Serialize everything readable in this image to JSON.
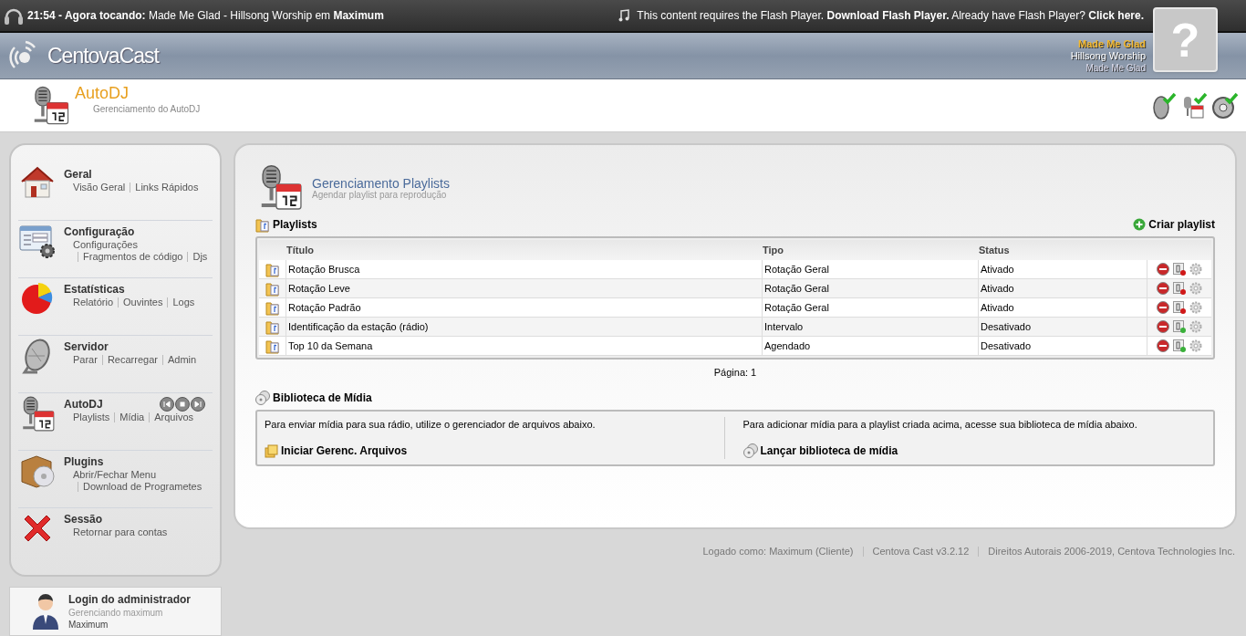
{
  "top_bar": {
    "time": "21:54 - ",
    "label": "Agora tocando:",
    "track": " Made Me Glad - Hillsong Worship em ",
    "station": "Maximum",
    "flash_notice": "This content requires the Flash Player.",
    "download_link": "Download Flash Player.",
    "already": "Already have Flash Player?",
    "click_link": "Click here."
  },
  "header": {
    "logo": "CentovaCast",
    "now_playing": {
      "title": "Made Me Glad",
      "artist": "Hillsong Worship",
      "album": "Made Me Glad"
    },
    "cover_placeholder": "?"
  },
  "page": {
    "title": "AutoDJ",
    "subtitle": "Gerenciamento do AutoDJ"
  },
  "sidebar": [
    {
      "kind": "house",
      "title": "Geral",
      "links": [
        "Visão Geral",
        "Links Rápidos"
      ]
    },
    {
      "kind": "form",
      "title": "Configuração",
      "links": [
        "Configurações",
        "Fragmentos de código",
        "Djs"
      ]
    },
    {
      "kind": "pie",
      "title": "Estatísticas",
      "links": [
        "Relatório",
        "Ouvintes",
        "Logs"
      ]
    },
    {
      "kind": "speaker",
      "title": "Servidor",
      "links": [
        "Parar",
        "Recarregar",
        "Admin"
      ]
    },
    {
      "kind": "autodj",
      "title": "AutoDJ",
      "links": [
        "Playlists",
        "Mídia",
        "Arquivos"
      ]
    },
    {
      "kind": "plugins",
      "title": "Plugins",
      "links": [
        "Abrir/Fechar Menu",
        "Download de Programetes"
      ]
    },
    {
      "kind": "session",
      "title": "Sessão",
      "links": [
        "Retornar para contas"
      ]
    }
  ],
  "admin": {
    "title": "Login do administrador",
    "subtitle": "Gerenciando maximum",
    "user": "Maximum"
  },
  "main": {
    "title": "Gerenciamento Playlists",
    "subtitle": "Agendar playlist para reprodução",
    "playlists": {
      "heading": "Playlists",
      "create": "Criar playlist",
      "columns": [
        "Título",
        "Tipo",
        "Status"
      ],
      "rows": [
        {
          "title": "Rotação Brusca",
          "type": "Rotação Geral",
          "status": "Ativado",
          "enabled": true
        },
        {
          "title": "Rotação Leve",
          "type": "Rotação Geral",
          "status": "Ativado",
          "enabled": true
        },
        {
          "title": "Rotação Padrão",
          "type": "Rotação Geral",
          "status": "Ativado",
          "enabled": true
        },
        {
          "title": "Identificação da estação (rádio)",
          "type": "Intervalo",
          "status": "Desativado",
          "enabled": false
        },
        {
          "title": "Top 10 da Semana",
          "type": "Agendado",
          "status": "Desativado",
          "enabled": false
        }
      ],
      "pagination": "Página: 1"
    },
    "library": {
      "heading": "Biblioteca de Mídia",
      "left_text": "Para enviar mídia para sua rádio, utilize o gerenciador de arquivos abaixo.",
      "left_link": "Iniciar Gerenc. Arquivos",
      "right_text": "Para adicionar mídia para a playlist criada acima, acesse sua biblioteca de mídia abaixo.",
      "right_link": "Lançar biblioteca de mídia"
    }
  },
  "footer": [
    "Logado como: Maximum (Cliente)",
    "Centova Cast v3.2.12",
    "Direitos Autorais 2006-2019, Centova Technologies Inc."
  ]
}
